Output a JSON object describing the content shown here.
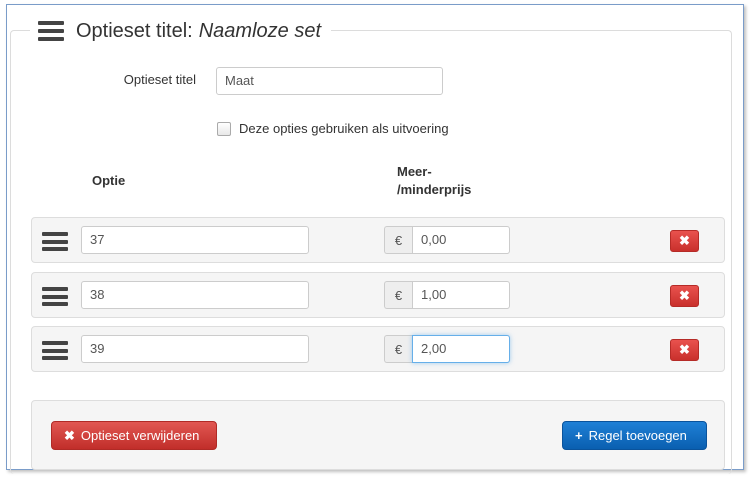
{
  "legend": {
    "prefix": "Optieset titel:",
    "name": "Naamloze set"
  },
  "title_field": {
    "label": "Optieset titel",
    "value": "Maat"
  },
  "checkbox": {
    "label": "Deze opties gebruiken als uitvoering",
    "checked": false
  },
  "columns": {
    "optie": "Optie",
    "prijs_line1": "Meer-",
    "prijs_line2": "/minderprijs"
  },
  "currency_symbol": "€",
  "rows": [
    {
      "optie": "37",
      "prijs": "0,00"
    },
    {
      "optie": "38",
      "prijs": "1,00"
    },
    {
      "optie": "39",
      "prijs": "2,00"
    }
  ],
  "delete_icon": "✖",
  "footer": {
    "remove_label": "Optieset verwijderen",
    "remove_icon": "✖",
    "add_label": "Regel toevoegen",
    "add_icon": "+"
  },
  "colors": {
    "danger": "#d9534f",
    "primary": "#1570c8",
    "focus": "#66afe9"
  }
}
